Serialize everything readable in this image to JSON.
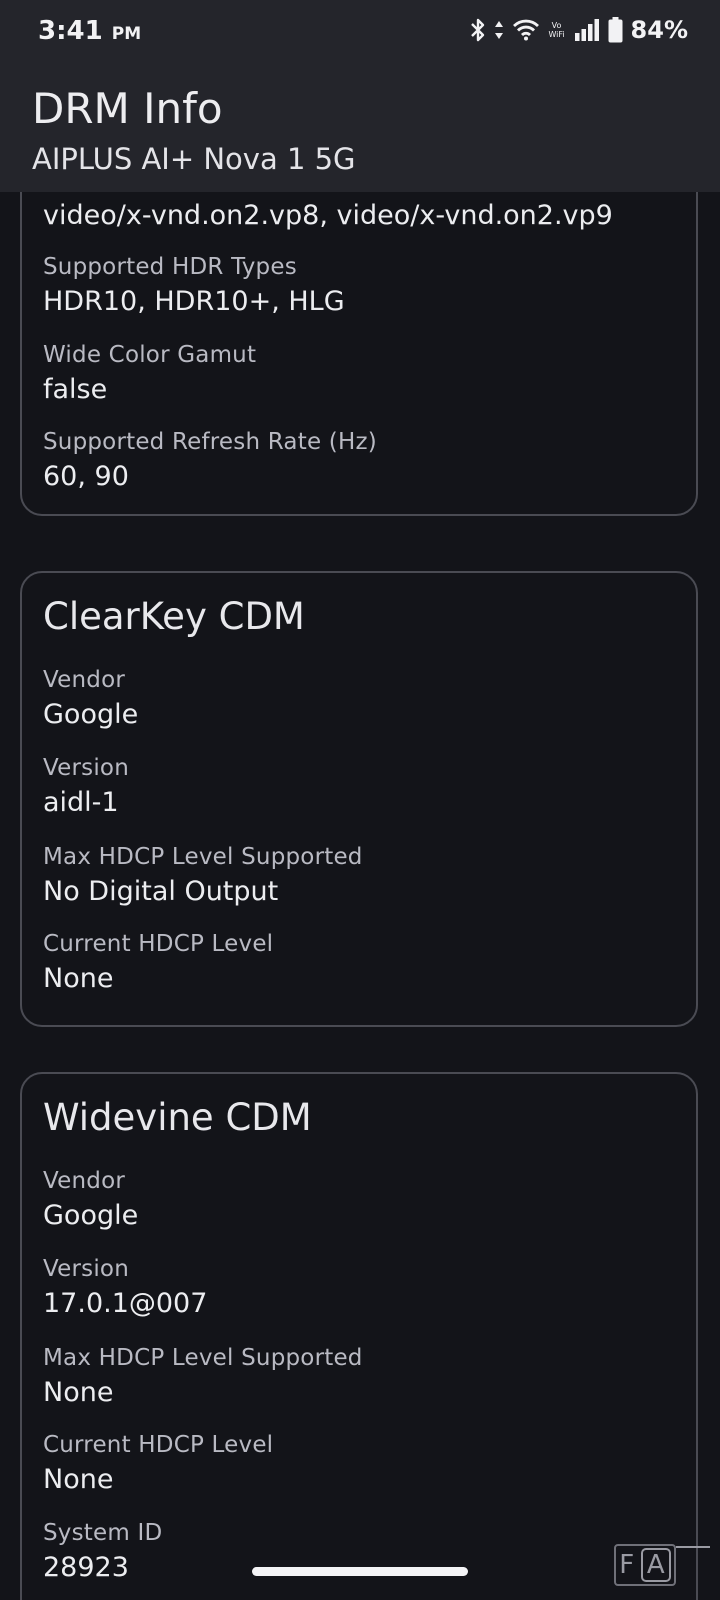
{
  "status_bar": {
    "time": "3:41",
    "ampm": "PM",
    "network_label": "Vo WiFi",
    "battery": "84%"
  },
  "app_bar": {
    "title": "DRM Info",
    "subtitle": "AIPLUS AI+ Nova 1 5G"
  },
  "display_card": {
    "partial_value": "video/x-vnd.on2.vp8, video/x-vnd.on2.vp9",
    "fields": [
      {
        "label": "Supported HDR Types",
        "value": "HDR10, HDR10+, HLG"
      },
      {
        "label": "Wide Color Gamut",
        "value": "false"
      },
      {
        "label": "Supported Refresh Rate (Hz)",
        "value": "60, 90"
      }
    ]
  },
  "clearkey_card": {
    "title": "ClearKey CDM",
    "fields": [
      {
        "label": "Vendor",
        "value": "Google"
      },
      {
        "label": "Version",
        "value": "aidl-1"
      },
      {
        "label": "Max HDCP Level Supported",
        "value": "No Digital Output"
      },
      {
        "label": "Current HDCP Level",
        "value": "None"
      }
    ]
  },
  "widevine_card": {
    "title": "Widevine CDM",
    "fields": [
      {
        "label": "Vendor",
        "value": "Google"
      },
      {
        "label": "Version",
        "value": "17.0.1@007"
      },
      {
        "label": "Max HDCP Level Supported",
        "value": "None"
      },
      {
        "label": "Current HDCP Level",
        "value": "None"
      },
      {
        "label": "System ID",
        "value": "28923"
      }
    ]
  },
  "overlay": {
    "fa_left": "F",
    "fa_right": "A"
  }
}
